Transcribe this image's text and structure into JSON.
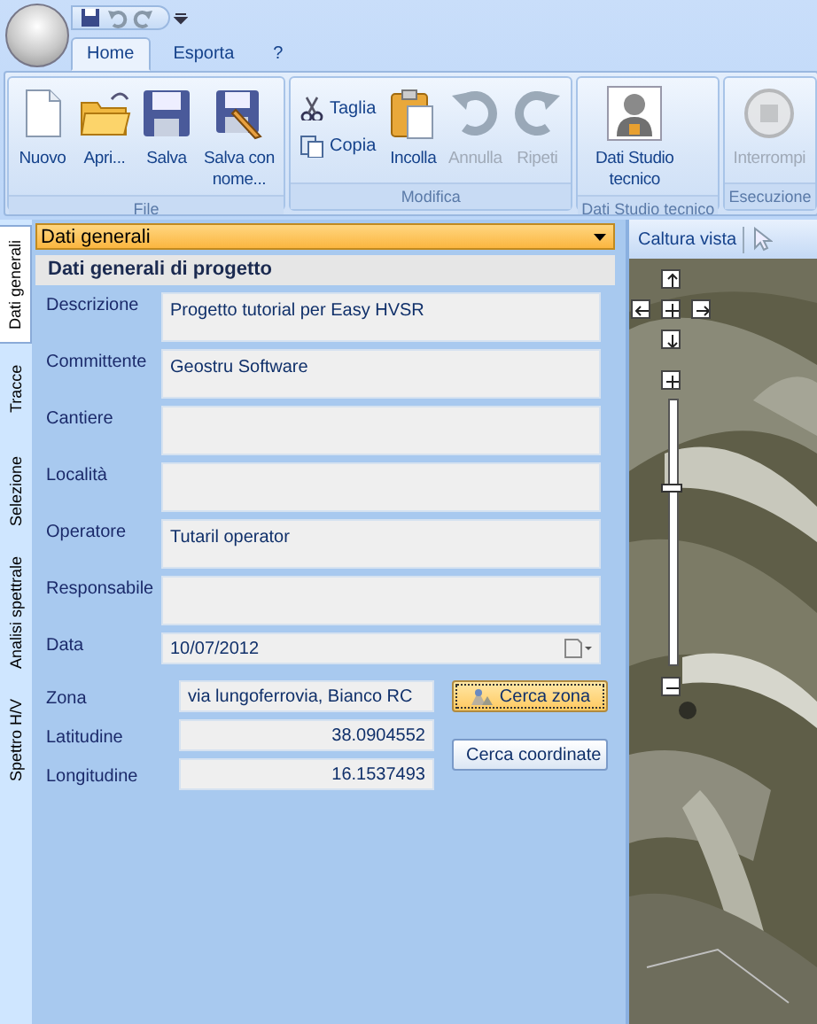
{
  "ribbon": {
    "tabs": [
      {
        "label": "Home",
        "selected": true
      },
      {
        "label": "Esporta",
        "selected": false
      },
      {
        "label": "?",
        "selected": false
      }
    ],
    "groups": [
      {
        "label": "File",
        "buttons": [
          {
            "label": "Nuovo",
            "kind": "large",
            "disabled": false
          },
          {
            "label": "Apri...",
            "kind": "large",
            "disabled": false
          },
          {
            "label": "Salva",
            "kind": "large",
            "disabled": false
          },
          {
            "label": "Salva con nome...",
            "kind": "large",
            "disabled": false
          }
        ]
      },
      {
        "label": "Modifica",
        "buttons": [
          {
            "label": "Taglia",
            "kind": "small",
            "disabled": false
          },
          {
            "label": "Copia",
            "kind": "small",
            "disabled": false
          },
          {
            "label": "Incolla",
            "kind": "large",
            "disabled": false
          },
          {
            "label": "Annulla",
            "kind": "large",
            "disabled": true
          },
          {
            "label": "Ripeti",
            "kind": "large",
            "disabled": true
          }
        ]
      },
      {
        "label": "Dati Studio tecnico",
        "buttons": [
          {
            "label": "Dati Studio tecnico",
            "kind": "large",
            "disabled": false
          }
        ]
      },
      {
        "label": "Esecuzione",
        "buttons": [
          {
            "label": "Interrompi",
            "kind": "large",
            "disabled": true
          }
        ]
      }
    ]
  },
  "side_tabs": [
    {
      "label": "Dati generali",
      "selected": true
    },
    {
      "label": "Tracce",
      "selected": false
    },
    {
      "label": "Selezione",
      "selected": false
    },
    {
      "label": "Analisi spettrale",
      "selected": false
    },
    {
      "label": "Spettro H/V",
      "selected": false
    }
  ],
  "form": {
    "dropdown": {
      "value": "Dati generali"
    },
    "section_title": "Dati generali di progetto",
    "fields": [
      {
        "label": "Descrizione",
        "value": "Progetto tutorial per Easy HVSR",
        "kind": "multiline"
      },
      {
        "label": "Committente",
        "value": "Geostru Software",
        "kind": "multiline"
      },
      {
        "label": "Cantiere",
        "kind": "multiline"
      },
      {
        "label": "Località",
        "kind": "multiline"
      },
      {
        "label": "Operatore",
        "value": "Tutaril operator",
        "kind": "multiline"
      },
      {
        "label": "Responsabile",
        "kind": "multiline"
      },
      {
        "label": "Data",
        "value": "10/07/2012",
        "kind": "date"
      }
    ],
    "location_fields": [
      {
        "label": "Zona",
        "value": "via lungoferrovia, Bianco RC",
        "kind": "text"
      },
      {
        "label": "Latitudine",
        "value": "38.0904552",
        "kind": "number"
      },
      {
        "label": "Longitudine",
        "value": "16.1537493",
        "kind": "number"
      }
    ],
    "buttons": [
      {
        "label": "Cerca zona",
        "default": true
      },
      {
        "label": "Cerca coordinate",
        "default": false
      }
    ]
  },
  "map": {
    "toolbar_label": "Caltura vista",
    "zoom": {
      "level": 0.66
    }
  }
}
